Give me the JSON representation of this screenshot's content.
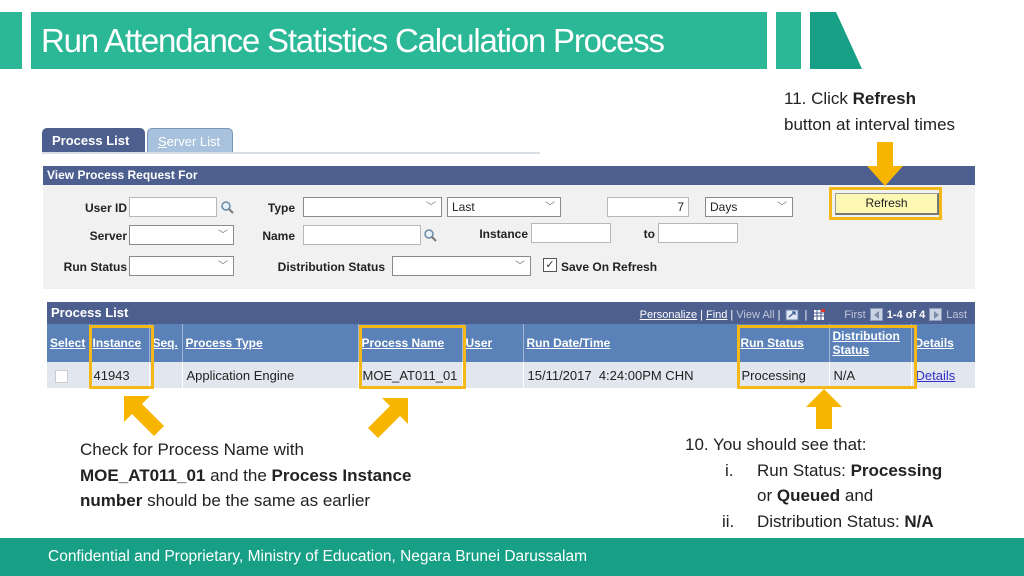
{
  "slide": {
    "title": "Run Attendance Statistics Calculation Process",
    "footer": "Confidential and Proprietary, Ministry of Education, Negara Brunei Darussalam",
    "accent_color": "#2ab896",
    "highlight_color": "#f4b819"
  },
  "tabs": [
    {
      "label": "Process List",
      "active": true
    },
    {
      "label_prefix": "S",
      "label_rest": "erver List",
      "active": false
    }
  ],
  "filter": {
    "section_title": "View Process Request For",
    "user_id": {
      "label": "User ID",
      "value": ""
    },
    "type": {
      "label": "Type",
      "value": ""
    },
    "period": {
      "value": "Last"
    },
    "period_count": {
      "value": "7"
    },
    "period_unit": {
      "value": "Days"
    },
    "server": {
      "label": "Server",
      "value": ""
    },
    "name": {
      "label": "Name",
      "value": ""
    },
    "instance_from": {
      "label": "Instance",
      "value": ""
    },
    "instance_to": {
      "label": "to",
      "value": ""
    },
    "run_status": {
      "label": "Run Status",
      "value": ""
    },
    "distribution_status": {
      "label": "Distribution Status",
      "value": ""
    },
    "save_on_refresh": {
      "label": "Save On Refresh",
      "checked": true,
      "mark": "✓"
    },
    "refresh_label": "Refresh"
  },
  "process_list": {
    "title": "Process List",
    "nav": {
      "personalize": "Personalize",
      "find": "Find",
      "view_all": "View All",
      "sep": "|",
      "first": "First",
      "range": "1-4 of 4",
      "last": "Last"
    },
    "columns": [
      "Select",
      "Instance",
      "Seq.",
      "Process Type",
      "Process Name",
      "User",
      "Run Date/Time",
      "Run Status",
      "Distribution Status",
      "Details"
    ],
    "rows": [
      {
        "select": false,
        "instance": "41943",
        "seq": "",
        "process_type": "Application Engine",
        "process_name": "MOE_AT011_01",
        "user": "",
        "run_datetime": "15/11/2017  4:24:00PM CHN",
        "run_status": "Processing",
        "distribution_status": "N/A",
        "details": "Details"
      }
    ]
  },
  "callouts": {
    "step11": {
      "prefix": "11. Click ",
      "bold": "Refresh",
      "line2": "button at interval times"
    },
    "check": {
      "line1": "Check for Process Name with",
      "bold1": "MOE_AT011_01",
      "mid": " and the ",
      "bold2": "Process Instance",
      "bold3": "number",
      "end": " should be the same as earlier"
    },
    "step10": {
      "heading": "10. You should see that:",
      "item1_marker": "i.",
      "item1_text": "Run Status: ",
      "item1_bold": "Processing",
      "item1_cont_pre": "or ",
      "item1_cont_bold": "Queued",
      "item1_cont_post": " and",
      "item2_marker": "ii.",
      "item2_text": "Distribution Status: ",
      "item2_bold": "N/A"
    }
  }
}
